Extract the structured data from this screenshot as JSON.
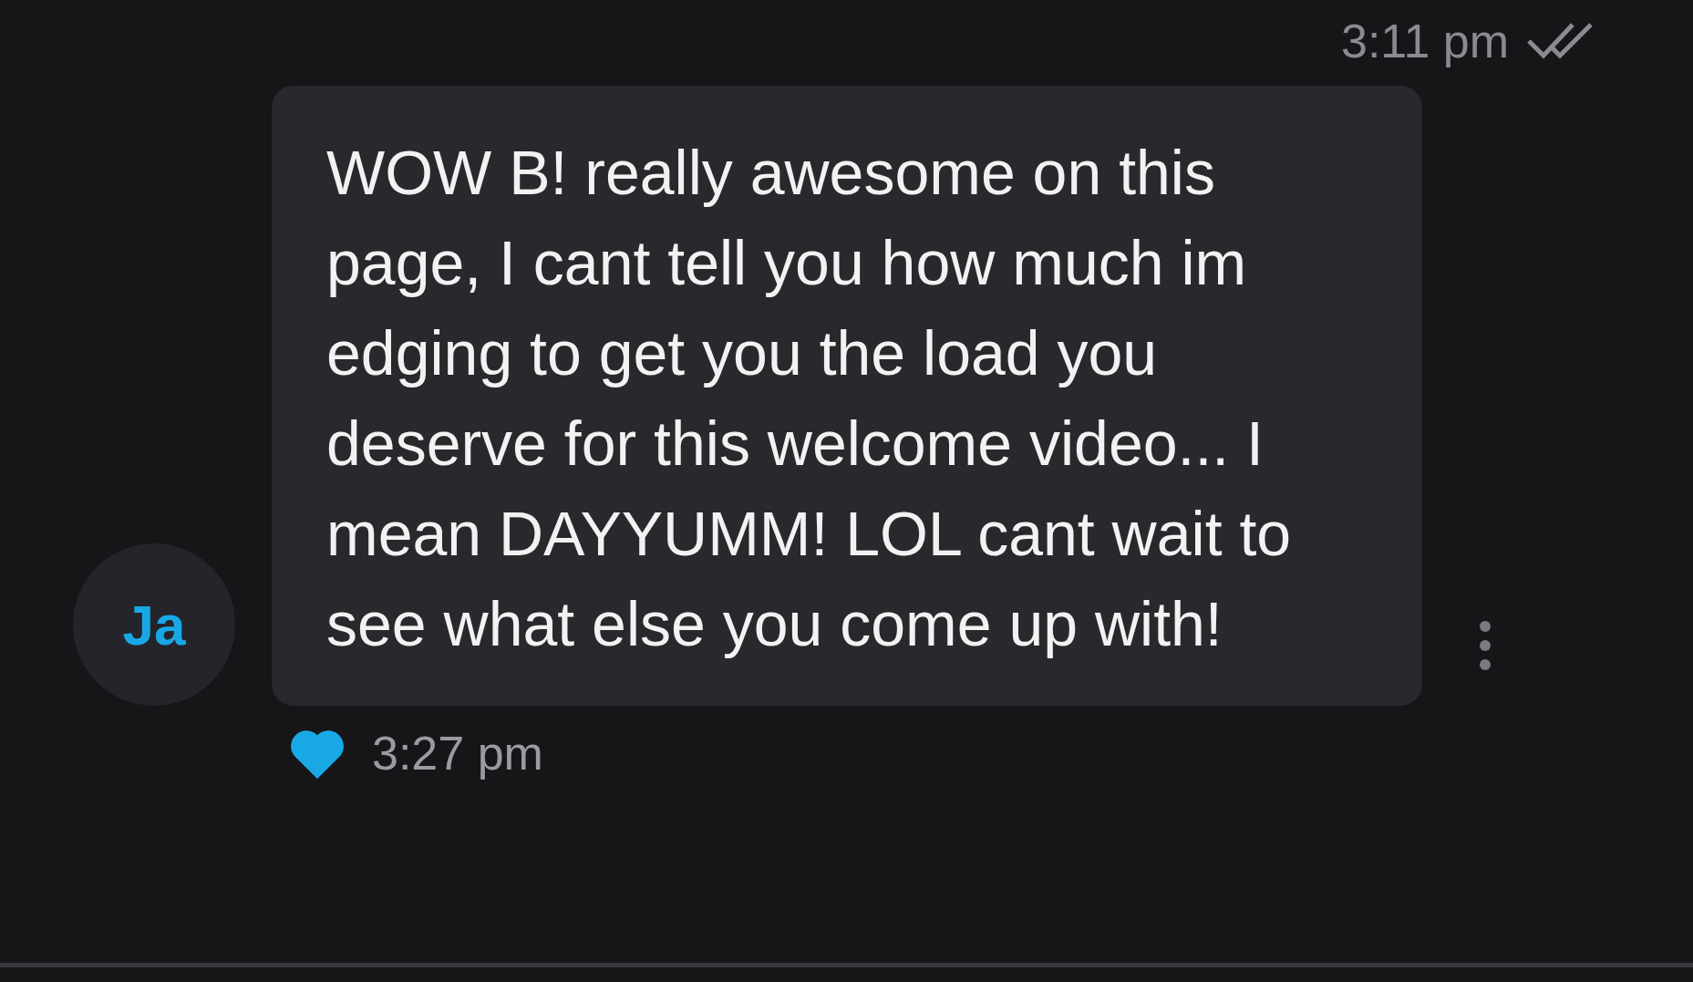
{
  "header": {
    "time": "3:11 pm",
    "read": true
  },
  "message": {
    "avatar": "Ja",
    "text": "WOW B! really awesome on this page, I cant tell you how much im edging to get you the load you deserve for this welcome video... I mean DAYYUMM! LOL cant wait to see what else you come up with!",
    "liked": true,
    "time": "3:27 pm"
  }
}
